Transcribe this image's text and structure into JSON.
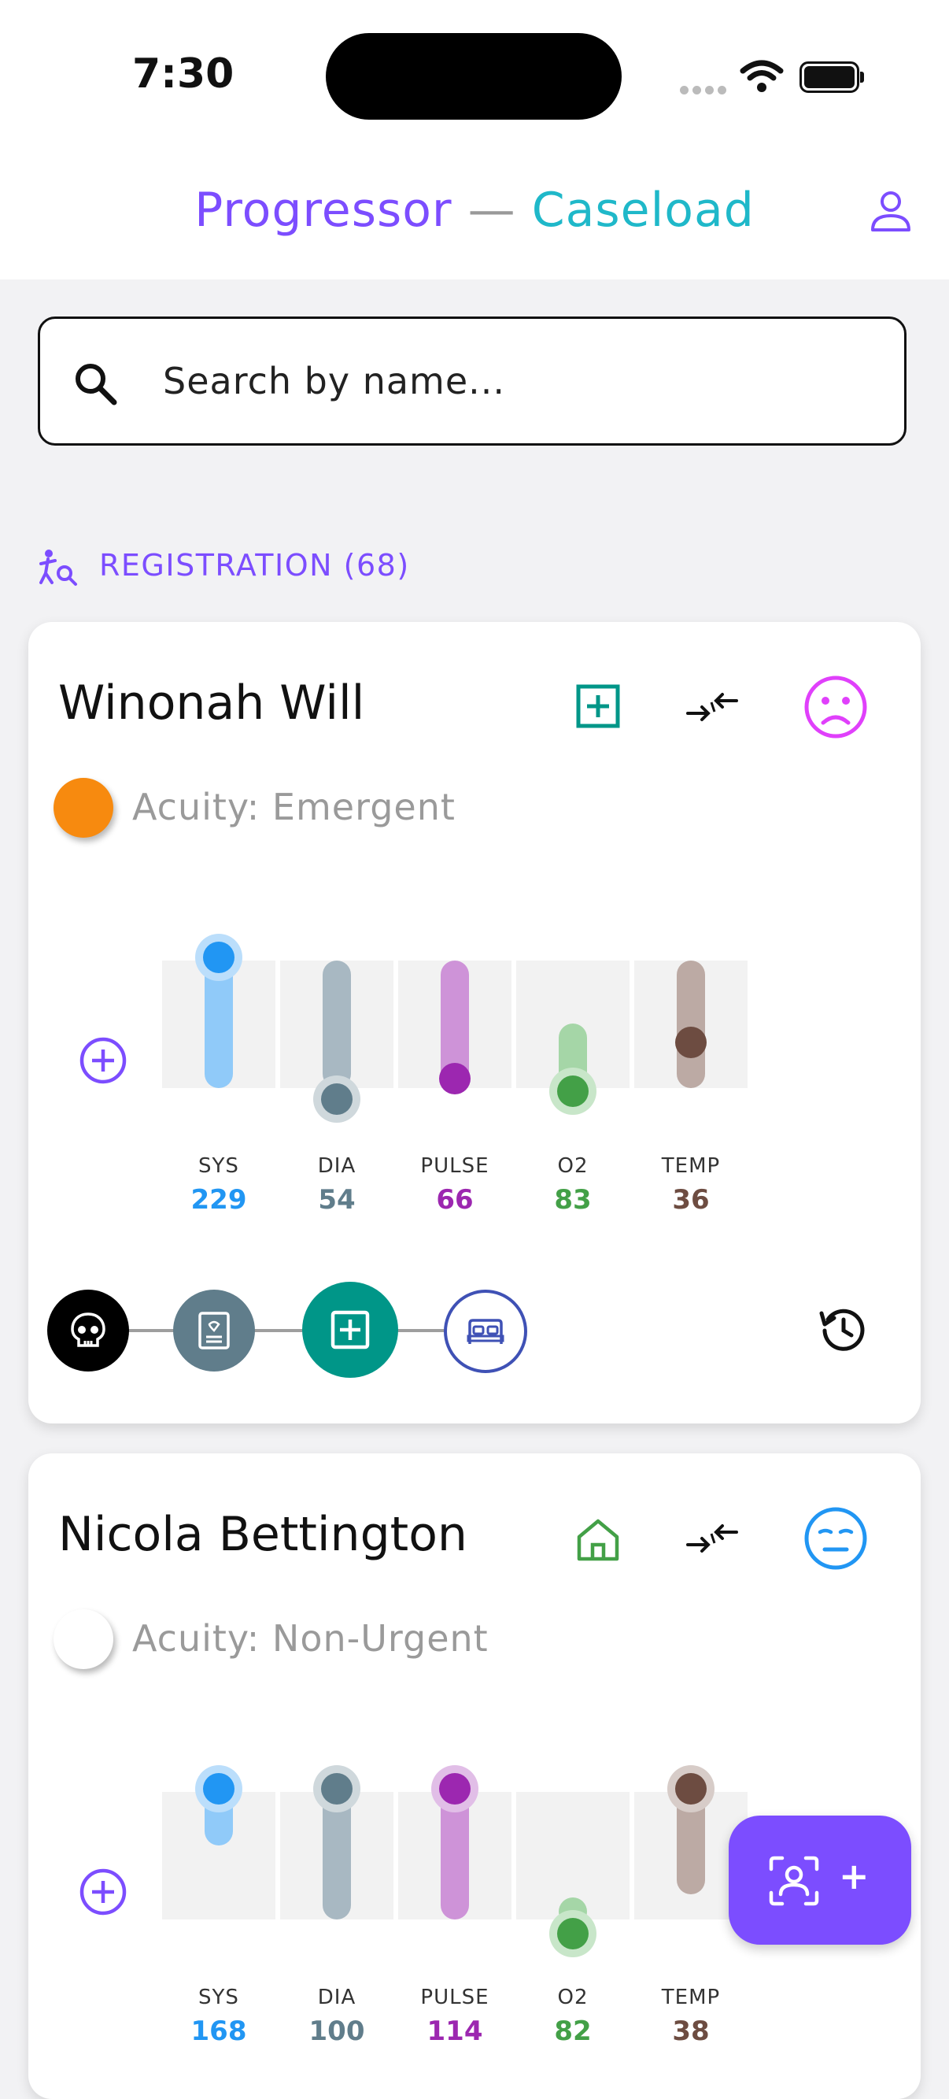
{
  "status_bar": {
    "time": "7:30"
  },
  "header": {
    "app_name": "Progressor",
    "separator": "—",
    "section": "Caseload"
  },
  "search": {
    "placeholder": "Search by name..."
  },
  "group": {
    "label": "REGISTRATION (68)"
  },
  "patients": [
    {
      "name": "Winonah Will",
      "acuity": "Acuity: Emergent",
      "acuity_color": "#f78a0f",
      "location_icon": "medical-plus-icon",
      "mood_icon": "sad-face-icon",
      "vitals": [
        {
          "label": "SYS",
          "value": "229",
          "color": "#2196f3"
        },
        {
          "label": "DIA",
          "value": "54",
          "color": "#607d8b"
        },
        {
          "label": "PULSE",
          "value": "66",
          "color": "#9c27b0"
        },
        {
          "label": "O2",
          "value": "83",
          "color": "#43a047"
        },
        {
          "label": "TEMP",
          "value": "36",
          "color": "#6d4c41"
        }
      ],
      "timeline": [
        "skull-icon",
        "chart-icon",
        "medical-plus-icon",
        "bed-icon"
      ]
    },
    {
      "name": "Nicola Bettington",
      "acuity": "Acuity: Non-Urgent",
      "acuity_color": "#ffffff",
      "location_icon": "home-icon",
      "mood_icon": "meh-face-icon",
      "vitals": [
        {
          "label": "SYS",
          "value": "168",
          "color": "#2196f3"
        },
        {
          "label": "DIA",
          "value": "100",
          "color": "#607d8b"
        },
        {
          "label": "PULSE",
          "value": "114",
          "color": "#9c27b0"
        },
        {
          "label": "O2",
          "value": "82",
          "color": "#43a047"
        },
        {
          "label": "TEMP",
          "value": "38",
          "color": "#6d4c41"
        }
      ]
    }
  ],
  "colors": {
    "accent": "#7c4dff",
    "teal": "#1fb8c9",
    "green_teal": "#009688"
  }
}
